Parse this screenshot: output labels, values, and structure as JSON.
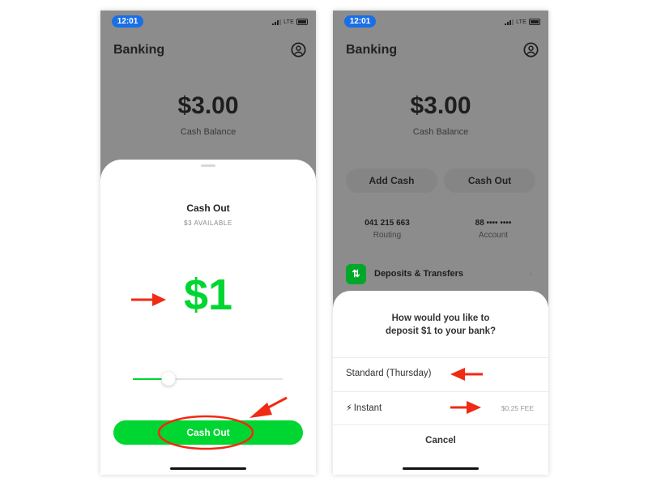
{
  "colors": {
    "accent_green": "#00d632",
    "status_blue": "#1a6fe6",
    "annotation_red": "#f02a13",
    "dim_overlay": "#8c8c8c"
  },
  "left_screen": {
    "status": {
      "time": "12:01",
      "network": "LTE"
    },
    "header": {
      "title": "Banking",
      "profile_icon": "profile-icon"
    },
    "balance": {
      "amount": "$3.00",
      "label": "Cash Balance"
    },
    "sheet": {
      "title": "Cash Out",
      "available": "$3 AVAILABLE",
      "amount": "$1",
      "slider_fraction": 0.24,
      "button_label": "Cash Out"
    }
  },
  "right_screen": {
    "status": {
      "time": "12:01",
      "network": "LTE"
    },
    "header": {
      "title": "Banking",
      "profile_icon": "profile-icon"
    },
    "balance": {
      "amount": "$3.00",
      "label": "Cash Balance"
    },
    "actions": {
      "add_cash": "Add Cash",
      "cash_out": "Cash Out"
    },
    "routing": {
      "number": "041 215 663",
      "label": "Routing"
    },
    "account": {
      "number": "88 •••• ••••",
      "label": "Account"
    },
    "deposits": {
      "icon": "transfer-arrows-icon",
      "icon_glyph": "⇅",
      "label": "Deposits & Transfers",
      "chevron": "›"
    },
    "sheet": {
      "question_line1": "How would you like to",
      "question_line2": "deposit $1 to your bank?",
      "options": [
        {
          "label": "Standard (Thursday)",
          "fee": ""
        },
        {
          "label": "Instant",
          "icon": "lightning-icon",
          "icon_glyph": "⚡︎",
          "fee": "$0.25 FEE"
        }
      ],
      "cancel_label": "Cancel"
    }
  }
}
